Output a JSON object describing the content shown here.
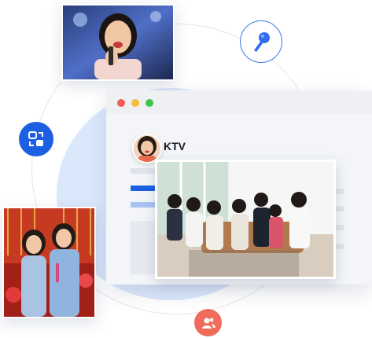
{
  "app": {
    "title": "KTV"
  },
  "window_controls": [
    "close",
    "minimize",
    "maximize"
  ],
  "icons": {
    "floating": [
      "microphone-icon",
      "swap-icon",
      "users-icon"
    ]
  },
  "colors": {
    "accent_blue": "#1c5fe3",
    "badge_red": "#ef6b5b",
    "blob_blue": "#dbe8fc",
    "nav_active": "#1c5fe3",
    "nav_inactive": "#a9c2f5"
  }
}
